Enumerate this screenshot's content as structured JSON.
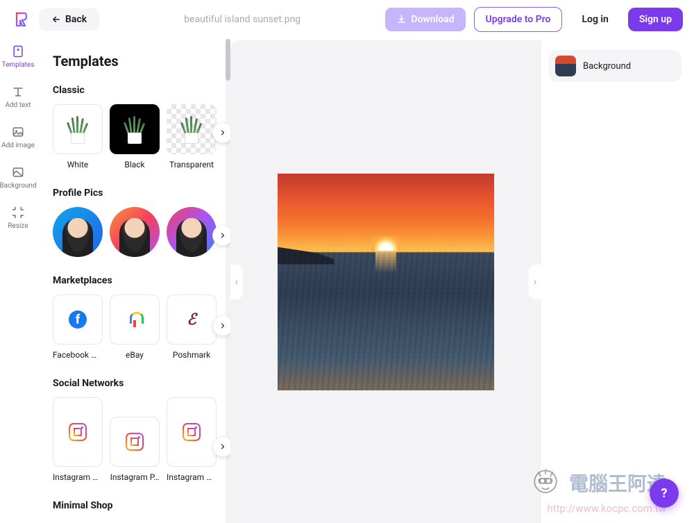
{
  "header": {
    "back": "Back",
    "filename": "beautiful island sunset.png",
    "download": "Download",
    "upgrade": "Upgrade to Pro",
    "login": "Log in",
    "signup": "Sign up"
  },
  "toolbar": {
    "items": [
      {
        "label": "Templates",
        "icon": "template"
      },
      {
        "label": "Add text",
        "icon": "text"
      },
      {
        "label": "Add image",
        "icon": "image"
      },
      {
        "label": "Background",
        "icon": "background"
      },
      {
        "label": "Resize",
        "icon": "resize"
      }
    ],
    "active_index": 0
  },
  "sidebar": {
    "title": "Templates",
    "sections": [
      {
        "title": "Classic",
        "items": [
          {
            "label": "White"
          },
          {
            "label": "Black"
          },
          {
            "label": "Transparent"
          }
        ]
      },
      {
        "title": "Profile Pics",
        "items": [
          {
            "label": ""
          },
          {
            "label": ""
          },
          {
            "label": ""
          }
        ]
      },
      {
        "title": "Marketplaces",
        "items": [
          {
            "label": "Facebook M…"
          },
          {
            "label": "eBay"
          },
          {
            "label": "Poshmark"
          }
        ]
      },
      {
        "title": "Social Networks",
        "items": [
          {
            "label": "Instagram S…"
          },
          {
            "label": "Instagram P…"
          },
          {
            "label": "Instagram R…"
          }
        ]
      },
      {
        "title": "Minimal Shop",
        "items": []
      }
    ]
  },
  "right_panel": {
    "background_label": "Background"
  },
  "watermark": {
    "text": "電腦王阿達",
    "url": "http://www.kocpc.com.tw"
  }
}
